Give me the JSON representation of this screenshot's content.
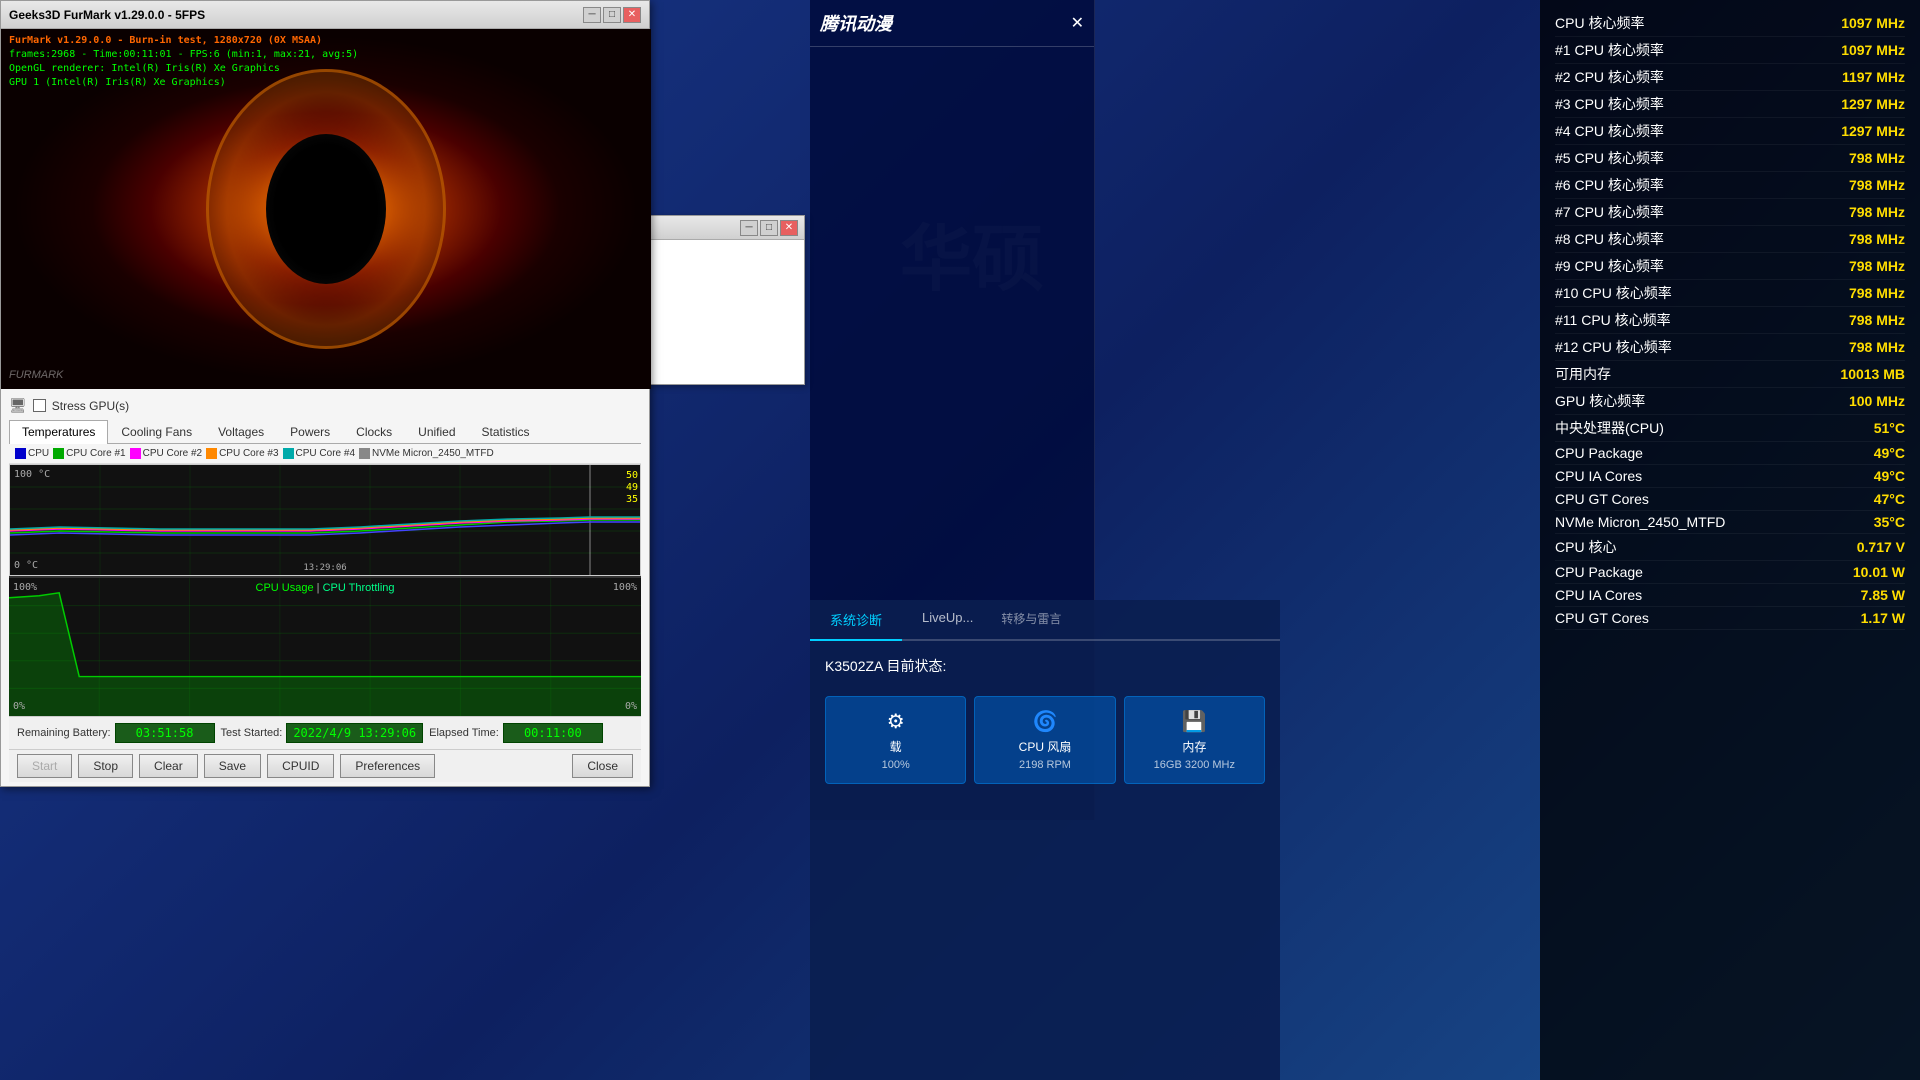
{
  "background": {
    "color": "#1a3a6e"
  },
  "furmark": {
    "title": "Geeks3D FurMark v1.29.0.0 - 5FPS",
    "overlay_lines": [
      "FurMark v1.29.0.0 - Burn-in test, 1280x720 (0X MSAA)",
      "frames:2968 - Time:00:11:01 - FPS:6 (min:1, max:21, avg:5)",
      "OpenGL renderer: Intel(R) Iris(R) Xe Graphics",
      "GPU 1 (Intel(R) Iris(R) Xe Graphics)"
    ],
    "watermark": "FURMARK",
    "stress_label": "Stress GPU(s)"
  },
  "tabs": {
    "items": [
      "Temperatures",
      "Cooling Fans",
      "Voltages",
      "Powers",
      "Clocks",
      "Unified",
      "Statistics"
    ],
    "active": "Temperatures"
  },
  "legend": {
    "items": [
      {
        "label": "CPU",
        "color": "#0000ff",
        "checked": true
      },
      {
        "label": "CPU Core #1",
        "color": "#00aa00",
        "checked": true
      },
      {
        "label": "CPU Core #2",
        "color": "#ff00ff",
        "checked": true
      },
      {
        "label": "CPU Core #3",
        "color": "#ff8800",
        "checked": true
      },
      {
        "label": "CPU Core #4",
        "color": "#00aaaa",
        "checked": true
      },
      {
        "label": "NVMe Micron_2450_MTFD",
        "color": "#888888",
        "checked": true
      }
    ]
  },
  "temp_chart": {
    "y_max": "100 °C",
    "y_min": "0 °C",
    "time_label": "13:29:06",
    "values": [
      "50",
      "49",
      "35"
    ]
  },
  "cpu_chart": {
    "title": "CPU Usage | CPU Throttling",
    "y_max_left": "100%",
    "y_min_left": "0%",
    "y_max_right": "100%",
    "y_min_right": "0%"
  },
  "battery_info": {
    "remaining_label": "Remaining Battery:",
    "remaining_value": "03:51:58",
    "test_started_label": "Test Started:",
    "test_started_value": "2022/4/9 13:29:06",
    "elapsed_label": "Elapsed Time:",
    "elapsed_value": "00:11:00"
  },
  "buttons": {
    "start": "Start",
    "stop": "Stop",
    "clear": "Clear",
    "save": "Save",
    "cpuid": "CPUID",
    "preferences": "Preferences",
    "close": "Close"
  },
  "right_panel": {
    "stats": [
      {
        "label": "CPU 核心频率",
        "value": "1097 MHz"
      },
      {
        "label": "#1 CPU 核心频率",
        "value": "1097 MHz"
      },
      {
        "label": "#2 CPU 核心频率",
        "value": "1197 MHz"
      },
      {
        "label": "#3 CPU 核心频率",
        "value": "1297 MHz"
      },
      {
        "label": "#4 CPU 核心频率",
        "value": "1297 MHz"
      },
      {
        "label": "#5 CPU 核心频率",
        "value": "798 MHz"
      },
      {
        "label": "#6 CPU 核心频率",
        "value": "798 MHz"
      },
      {
        "label": "#7 CPU 核心频率",
        "value": "798 MHz"
      },
      {
        "label": "#8 CPU 核心频率",
        "value": "798 MHz"
      },
      {
        "label": "#9 CPU 核心频率",
        "value": "798 MHz"
      },
      {
        "label": "#10 CPU 核心频率",
        "value": "798 MHz"
      },
      {
        "label": "#11 CPU 核心频率",
        "value": "798 MHz"
      },
      {
        "label": "#12 CPU 核心频率",
        "value": "798 MHz"
      },
      {
        "label": "可用内存",
        "value": "10013 MB"
      },
      {
        "label": "GPU 核心频率",
        "value": "100 MHz"
      },
      {
        "label": "中央处理器(CPU)",
        "value": "51°C"
      },
      {
        "label": "CPU Package",
        "value": "49°C"
      },
      {
        "label": "CPU IA Cores",
        "value": "49°C"
      },
      {
        "label": "CPU GT Cores",
        "value": "47°C"
      },
      {
        "label": "NVMe Micron_2450_MTFD",
        "value": "35°C"
      },
      {
        "label": "CPU 核心",
        "value": "0.717 V"
      },
      {
        "label": "CPU Package",
        "value": "10.01 W"
      },
      {
        "label": "CPU IA Cores",
        "value": "7.85 W"
      },
      {
        "label": "CPU GT Cores",
        "value": "1.17 W"
      }
    ]
  },
  "tencent": {
    "logo": "腾讯动漫"
  },
  "system_diag": {
    "tabs": [
      "系统诊断",
      "LiveUp..."
    ],
    "active_tab": "系统诊断",
    "device": "K3502ZA 目前状态:",
    "buttons": [
      {
        "icon": "⚙",
        "label": "载",
        "sub": "100%"
      },
      {
        "icon": "🌀",
        "label": "CPU 风扇",
        "sub": "2198 RPM"
      },
      {
        "icon": "💾",
        "label": "内存",
        "sub": "16GB 3200 MHz"
      }
    ]
  },
  "secondary_window": {
    "visible": true
  }
}
